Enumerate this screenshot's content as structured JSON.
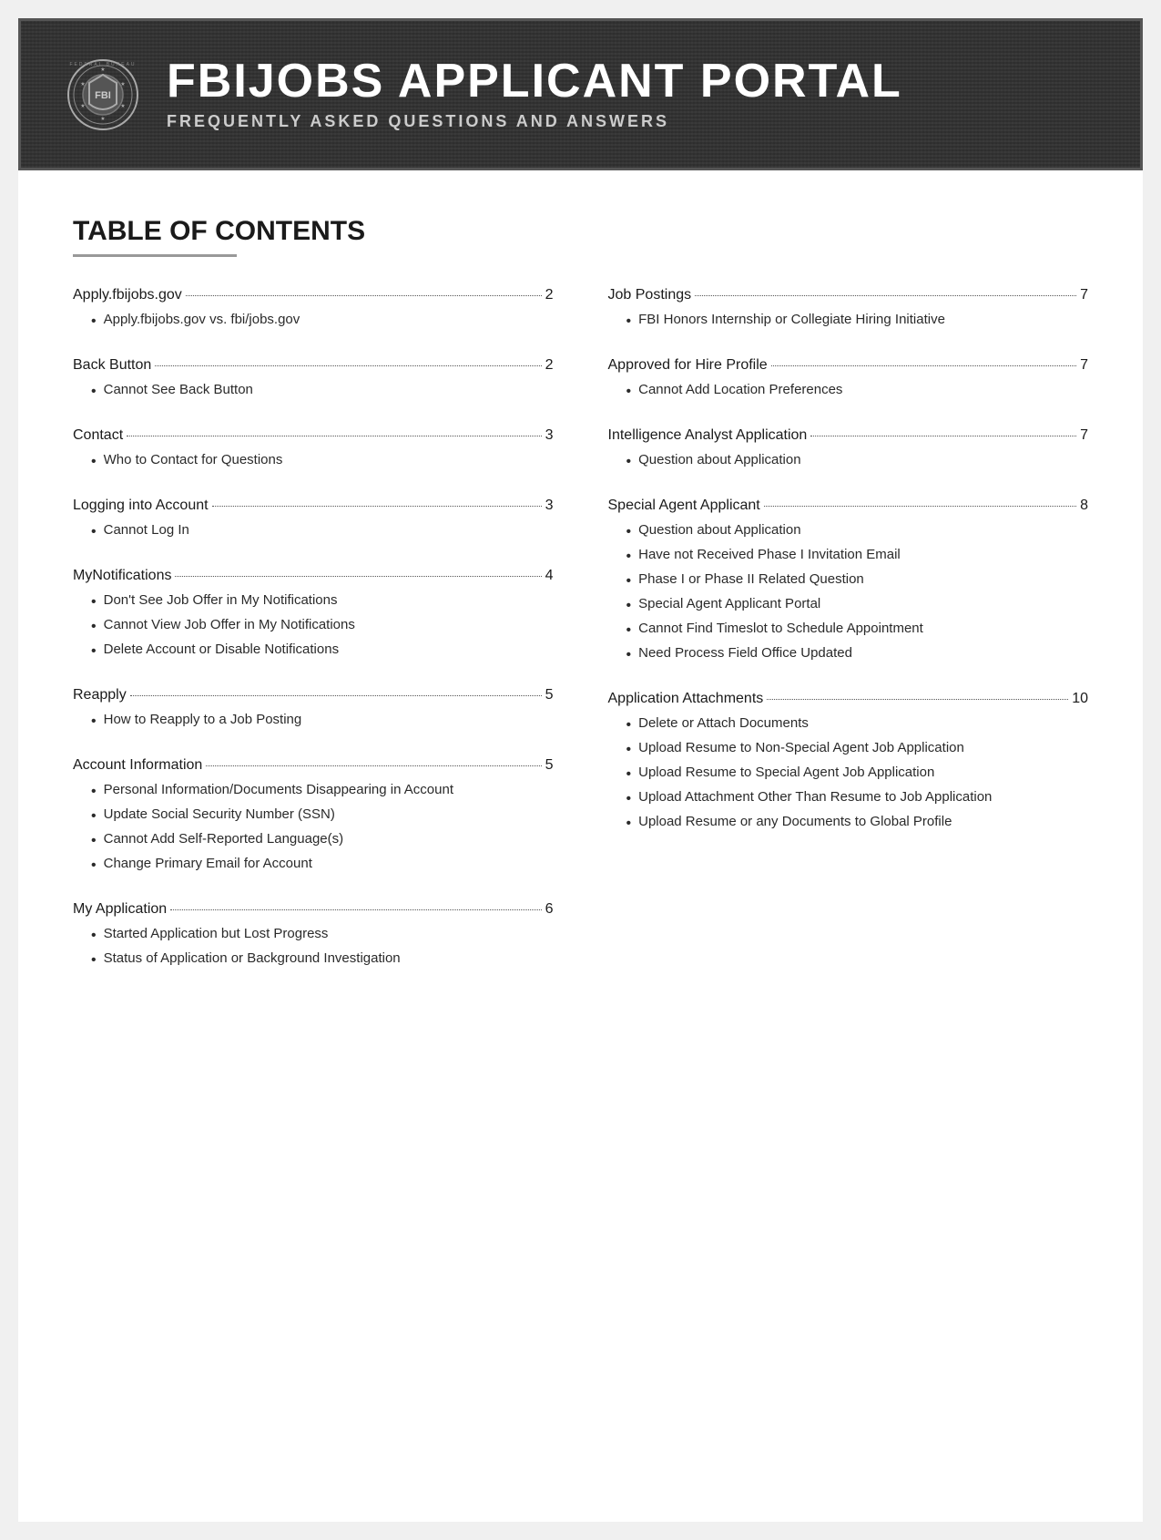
{
  "header": {
    "title": "FBIJOBS APPLICANT PORTAL",
    "subtitle": "FREQUENTLY ASKED QUESTIONS AND ANSWERS"
  },
  "toc": {
    "heading": "TABLE OF CONTENTS",
    "left_column": [
      {
        "label": "Apply.fbijobs.gov",
        "page": "2",
        "subitems": [
          "Apply.fbijobs.gov vs. fbi/jobs.gov"
        ]
      },
      {
        "label": "Back Button",
        "page": "2",
        "subitems": [
          "Cannot See Back Button"
        ]
      },
      {
        "label": "Contact",
        "page": "3",
        "subitems": [
          "Who to Contact for Questions"
        ]
      },
      {
        "label": "Logging into Account",
        "page": "3",
        "subitems": [
          "Cannot Log In"
        ]
      },
      {
        "label": "MyNotifications",
        "page": "4",
        "subitems": [
          "Don't See Job Offer in My Notifications",
          "Cannot View Job Offer in My Notifications",
          "Delete Account or Disable Notifications"
        ]
      },
      {
        "label": "Reapply",
        "page": "5",
        "subitems": [
          "How to Reapply to a Job Posting"
        ]
      },
      {
        "label": "Account Information",
        "page": "5",
        "subitems": [
          "Personal Information/Documents Disappearing in Account",
          "Update Social Security Number (SSN)",
          "Cannot Add Self-Reported Language(s)",
          "Change Primary Email for Account"
        ]
      },
      {
        "label": "My Application",
        "page": "6",
        "subitems": [
          "Started Application but Lost Progress",
          "Status of Application or Background Investigation"
        ]
      }
    ],
    "right_column": [
      {
        "label": "Job Postings",
        "page": "7",
        "subitems": [
          "FBI Honors Internship or Collegiate Hiring Initiative"
        ]
      },
      {
        "label": "Approved for Hire Profile",
        "page": "7",
        "subitems": [
          "Cannot Add Location Preferences"
        ]
      },
      {
        "label": "Intelligence Analyst Application",
        "page": "7",
        "subitems": [
          "Question about Application"
        ]
      },
      {
        "label": "Special Agent Applicant",
        "page": "8",
        "subitems": [
          "Question about Application",
          "Have not Received Phase I Invitation Email",
          "Phase I or Phase II Related Question",
          "Special Agent Applicant Portal",
          "Cannot Find Timeslot to Schedule Appointment",
          "Need Process Field Office Updated"
        ]
      },
      {
        "label": "Application Attachments",
        "page": "10",
        "subitems": [
          "Delete or Attach Documents",
          "Upload Resume to Non-Special Agent Job Application",
          "Upload Resume to Special Agent Job Application",
          "Upload Attachment Other Than Resume to Job Application",
          "Upload Resume or any Documents to Global Profile"
        ]
      }
    ]
  }
}
